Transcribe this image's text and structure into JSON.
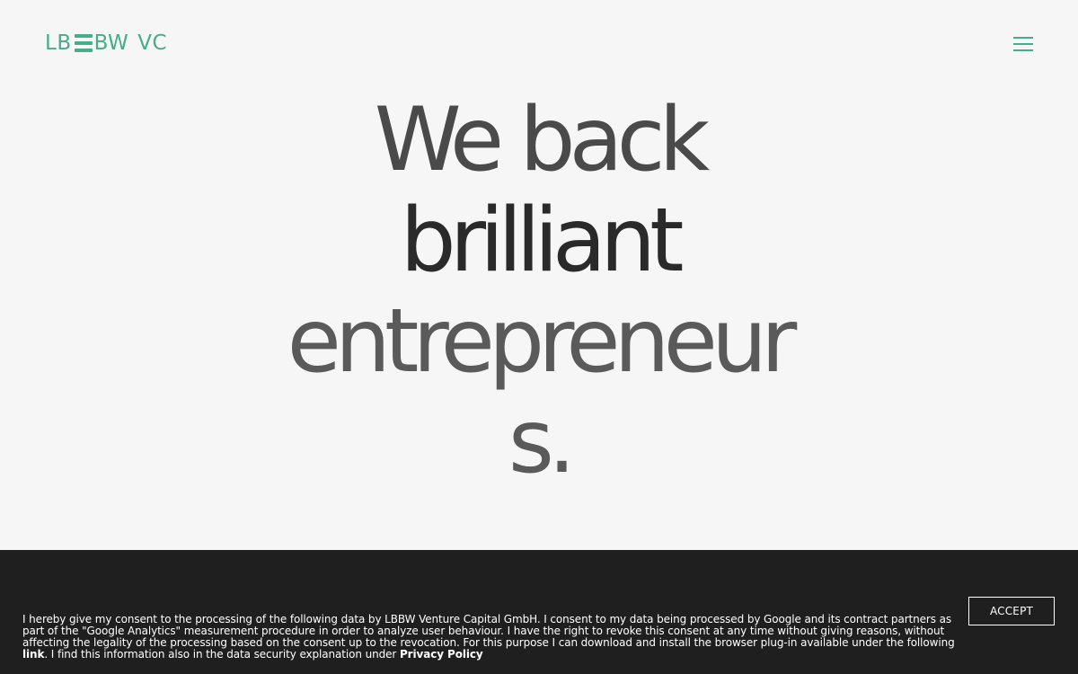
{
  "header": {
    "logo": {
      "part1": "LB",
      "part2": "BW",
      "part3": "VC"
    },
    "menu_icon": "hamburger-menu-icon"
  },
  "hero": {
    "line1": "We back",
    "line2": "brilliant",
    "line3": "entrepreneurs."
  },
  "consent": {
    "text_before_link": "I hereby give my consent to the processing of the following data by LBBW Venture Capital GmbH.  I consent to my data being processed by Google and its contract partners as part of the \"Google Analytics\" measurement procedure in order to analyze user behaviour. I have the right to revoke this consent at any time without giving reasons, without affecting the legality of the processing based on the consent up to the revocation. For this purpose I can download and install the browser plug-in available under the following ",
    "link_label": "link",
    "text_after_link": ". I find this information also in the data security explanation under ",
    "privacy_label": "Privacy Policy",
    "accept_label": "ACCEPT"
  },
  "colors": {
    "brand": "#45ad8b",
    "footer_bg": "#201f20",
    "page_bg": "#f6f6f6"
  }
}
